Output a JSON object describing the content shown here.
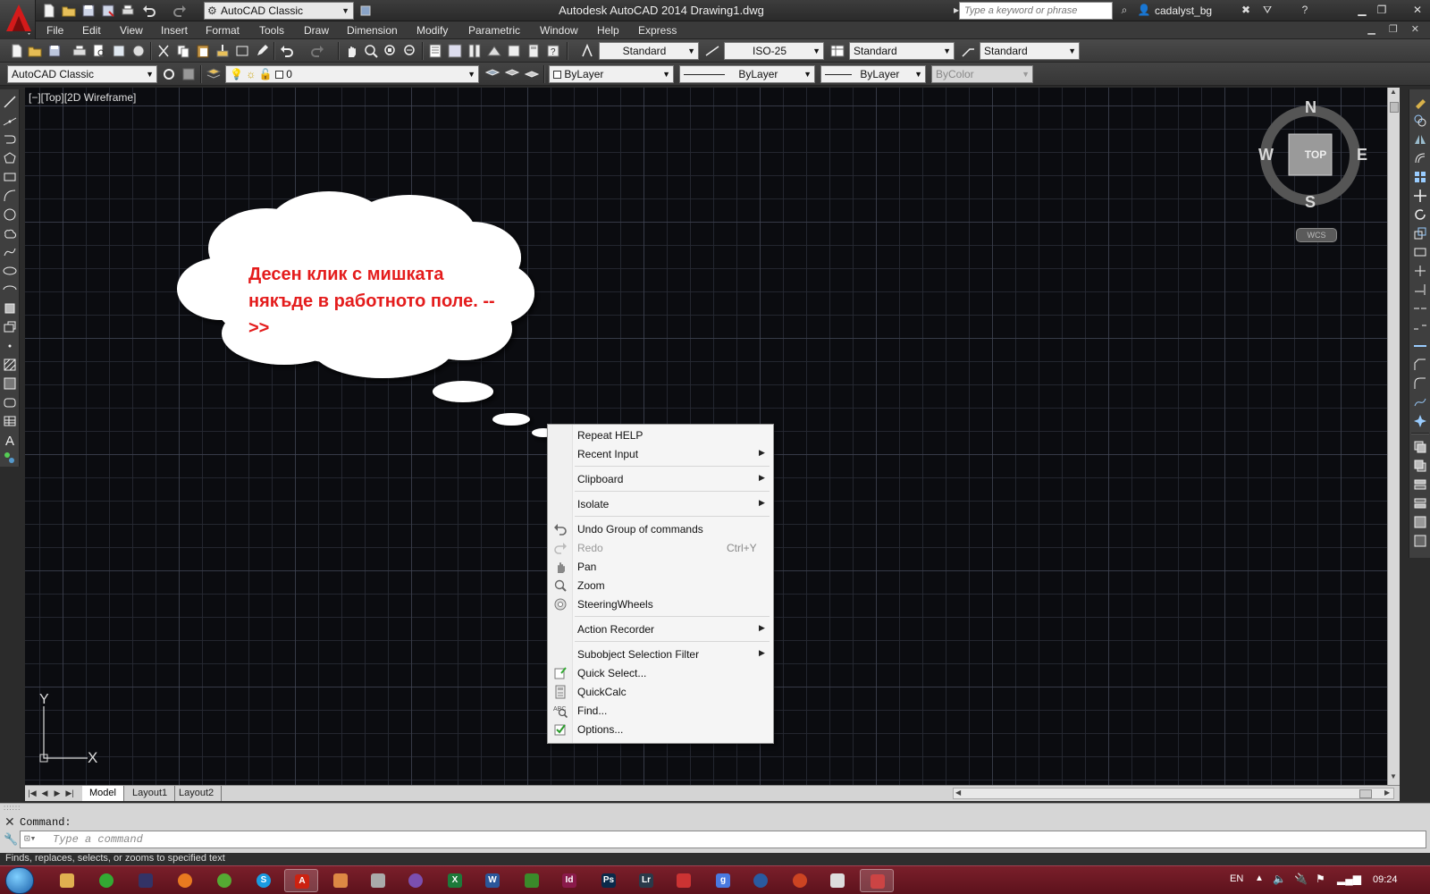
{
  "titlebar": {
    "workspace": "AutoCAD Classic",
    "title": "Autodesk AutoCAD 2014    Drawing1.dwg",
    "search_placeholder": "Type a keyword or phrase",
    "user": "cadalyst_bg"
  },
  "menubar": {
    "items": [
      "File",
      "Edit",
      "View",
      "Insert",
      "Format",
      "Tools",
      "Draw",
      "Dimension",
      "Modify",
      "Parametric",
      "Window",
      "Help",
      "Express"
    ]
  },
  "toolbar1": {
    "text_style": "Standard",
    "dim_style": "ISO-25",
    "table_style": "Standard",
    "mleader_style": "Standard"
  },
  "toolbar2": {
    "workspace": "AutoCAD Classic",
    "layer": "0",
    "color": "ByLayer",
    "linetype": "ByLayer",
    "lineweight": "ByLayer",
    "plotstyle": "ByColor"
  },
  "viewport": {
    "label": "[−][Top][2D Wireframe]"
  },
  "viewcube": {
    "north": "N",
    "south": "S",
    "east": "E",
    "west": "W",
    "face": "TOP",
    "wcs": "WCS"
  },
  "ucs": {
    "x": "X",
    "y": "Y"
  },
  "callout": {
    "text": "Десен клик с мишката някъде в работното поле. -->>"
  },
  "context_menu": {
    "items": [
      {
        "label": "Repeat HELP"
      },
      {
        "label": "Recent Input",
        "submenu": true
      },
      {
        "label": "Clipboard",
        "submenu": true
      },
      {
        "label": "Isolate",
        "submenu": true
      },
      {
        "label": "Undo Group of commands",
        "icon": "undo-icon"
      },
      {
        "label": "Redo",
        "shortcut": "Ctrl+Y",
        "disabled": true,
        "icon": "redo-icon"
      },
      {
        "label": "Pan",
        "icon": "pan-icon"
      },
      {
        "label": "Zoom",
        "icon": "zoom-icon"
      },
      {
        "label": "SteeringWheels",
        "icon": "steeringwheels-icon"
      },
      {
        "label": "Action Recorder",
        "submenu": true
      },
      {
        "label": "Subobject Selection Filter",
        "submenu": true
      },
      {
        "label": "Quick Select...",
        "icon": "quick-select-icon"
      },
      {
        "label": "QuickCalc",
        "icon": "calculator-icon"
      },
      {
        "label": "Find...",
        "icon": "find-icon"
      },
      {
        "label": "Options...",
        "icon": "options-checkbox-icon"
      }
    ]
  },
  "layout_tabs": [
    "Model",
    "Layout1",
    "Layout2"
  ],
  "command_line": {
    "history": "Command:",
    "placeholder": "Type a command"
  },
  "status_bar": {
    "text": "Finds, replaces, selects, or zooms to specified text"
  },
  "taskbar": {
    "language": "EN",
    "clock": "09:24"
  },
  "colors": {
    "canvas": "#0b0c10",
    "callout_text": "#e41c1c",
    "arrow": "#d82020",
    "taskbar": "#6b1822"
  }
}
